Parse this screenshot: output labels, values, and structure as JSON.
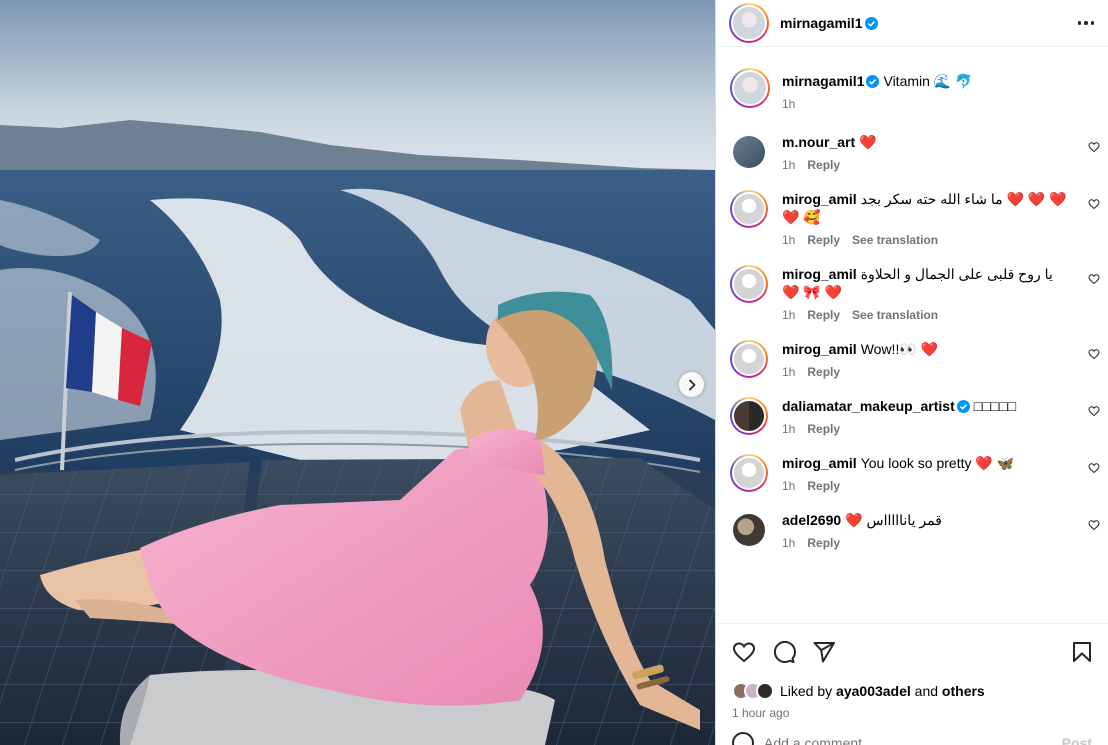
{
  "post": {
    "author": "mirnagamil1",
    "caption": "Vitamin 🌊 🐬",
    "caption_time": "1h"
  },
  "comments": [
    {
      "user": "m.nour_art",
      "text": "❤️",
      "time": "1h",
      "reply": "Reply",
      "translation": ""
    },
    {
      "user": "mirog_amil",
      "text": "ما شاء الله حته سكر بجد ❤️ ❤️ ❤️ ❤️ 🥰",
      "time": "1h",
      "reply": "Reply",
      "translation": "See translation"
    },
    {
      "user": "mirog_amil",
      "text": "يا روح قلبى على الجمال و الحلاوة ❤️ 🎀 ❤️",
      "time": "1h",
      "reply": "Reply",
      "translation": "See translation"
    },
    {
      "user": "mirog_amil",
      "text": "Wow!!👀 ❤️",
      "time": "1h",
      "reply": "Reply",
      "translation": ""
    },
    {
      "user": "daliamatar_makeup_artist",
      "text": "□□□□□",
      "time": "1h",
      "reply": "Reply",
      "translation": ""
    },
    {
      "user": "mirog_amil",
      "text": "You look so pretty ❤️ 🦋",
      "time": "1h",
      "reply": "Reply",
      "translation": ""
    },
    {
      "user": "adel2690",
      "text": "❤️ قمر ياناااااس",
      "time": "1h",
      "reply": "Reply",
      "translation": ""
    }
  ],
  "likes": {
    "prefix": "Liked by",
    "user": "aya003adel",
    "joiner": "and",
    "others": "others"
  },
  "posted_ago": "1 hour ago",
  "add_comment": {
    "placeholder": "Add a comment…",
    "post_label": "Post"
  },
  "icons": {
    "more": "more-horizontal-icon",
    "verified": "verified-badge-icon",
    "like": "heart-icon",
    "comment": "comment-bubble-icon",
    "share": "paper-plane-icon",
    "save": "bookmark-icon",
    "next": "chevron-right-icon",
    "emoji": "emoji-icon"
  },
  "colors": {
    "verified": "#0095f6",
    "heart": "#e41e3f",
    "muted": "#737373"
  }
}
